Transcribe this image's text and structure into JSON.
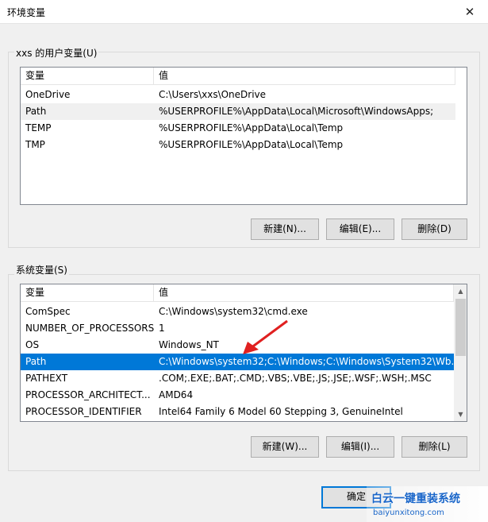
{
  "window": {
    "title": "环境变量",
    "close_glyph": "✕"
  },
  "user_vars": {
    "group_label": "xxs 的用户变量(U)",
    "columns": [
      "变量",
      "值"
    ],
    "rows": [
      {
        "name": "OneDrive",
        "value": "C:\\Users\\xxs\\OneDrive"
      },
      {
        "name": "Path",
        "value": "%USERPROFILE%\\AppData\\Local\\Microsoft\\WindowsApps;"
      },
      {
        "name": "TEMP",
        "value": "%USERPROFILE%\\AppData\\Local\\Temp"
      },
      {
        "name": "TMP",
        "value": "%USERPROFILE%\\AppData\\Local\\Temp"
      }
    ],
    "buttons": {
      "new": "新建(N)...",
      "edit": "编辑(E)...",
      "delete": "删除(D)"
    }
  },
  "system_vars": {
    "group_label": "系统变量(S)",
    "columns": [
      "变量",
      "值"
    ],
    "rows": [
      {
        "name": "ComSpec",
        "value": "C:\\Windows\\system32\\cmd.exe"
      },
      {
        "name": "NUMBER_OF_PROCESSORS",
        "value": "1"
      },
      {
        "name": "OS",
        "value": "Windows_NT"
      },
      {
        "name": "Path",
        "value": "C:\\Windows\\system32;C:\\Windows;C:\\Windows\\System32\\Wb..."
      },
      {
        "name": "PATHEXT",
        "value": ".COM;.EXE;.BAT;.CMD;.VBS;.VBE;.JS;.JSE;.WSF;.WSH;.MSC"
      },
      {
        "name": "PROCESSOR_ARCHITECT...",
        "value": "AMD64"
      },
      {
        "name": "PROCESSOR_IDENTIFIER",
        "value": "Intel64 Family 6 Model 60 Stepping 3, GenuineIntel"
      }
    ],
    "selected_row": 3,
    "buttons": {
      "new": "新建(W)...",
      "edit": "编辑(I)...",
      "delete": "删除(L)"
    }
  },
  "footer": {
    "ok": "确定"
  },
  "watermark": {
    "brand": "白云一键重装系统",
    "url": "baiyunxitong.com"
  },
  "colors": {
    "selection": "#0078d7",
    "arrow": "#e02020",
    "watermark": "#1a66c9"
  },
  "icons": {
    "scroll_up": "scroll-up-arrow-icon",
    "scroll_down": "scroll-down-arrow-icon",
    "close": "close-icon"
  }
}
